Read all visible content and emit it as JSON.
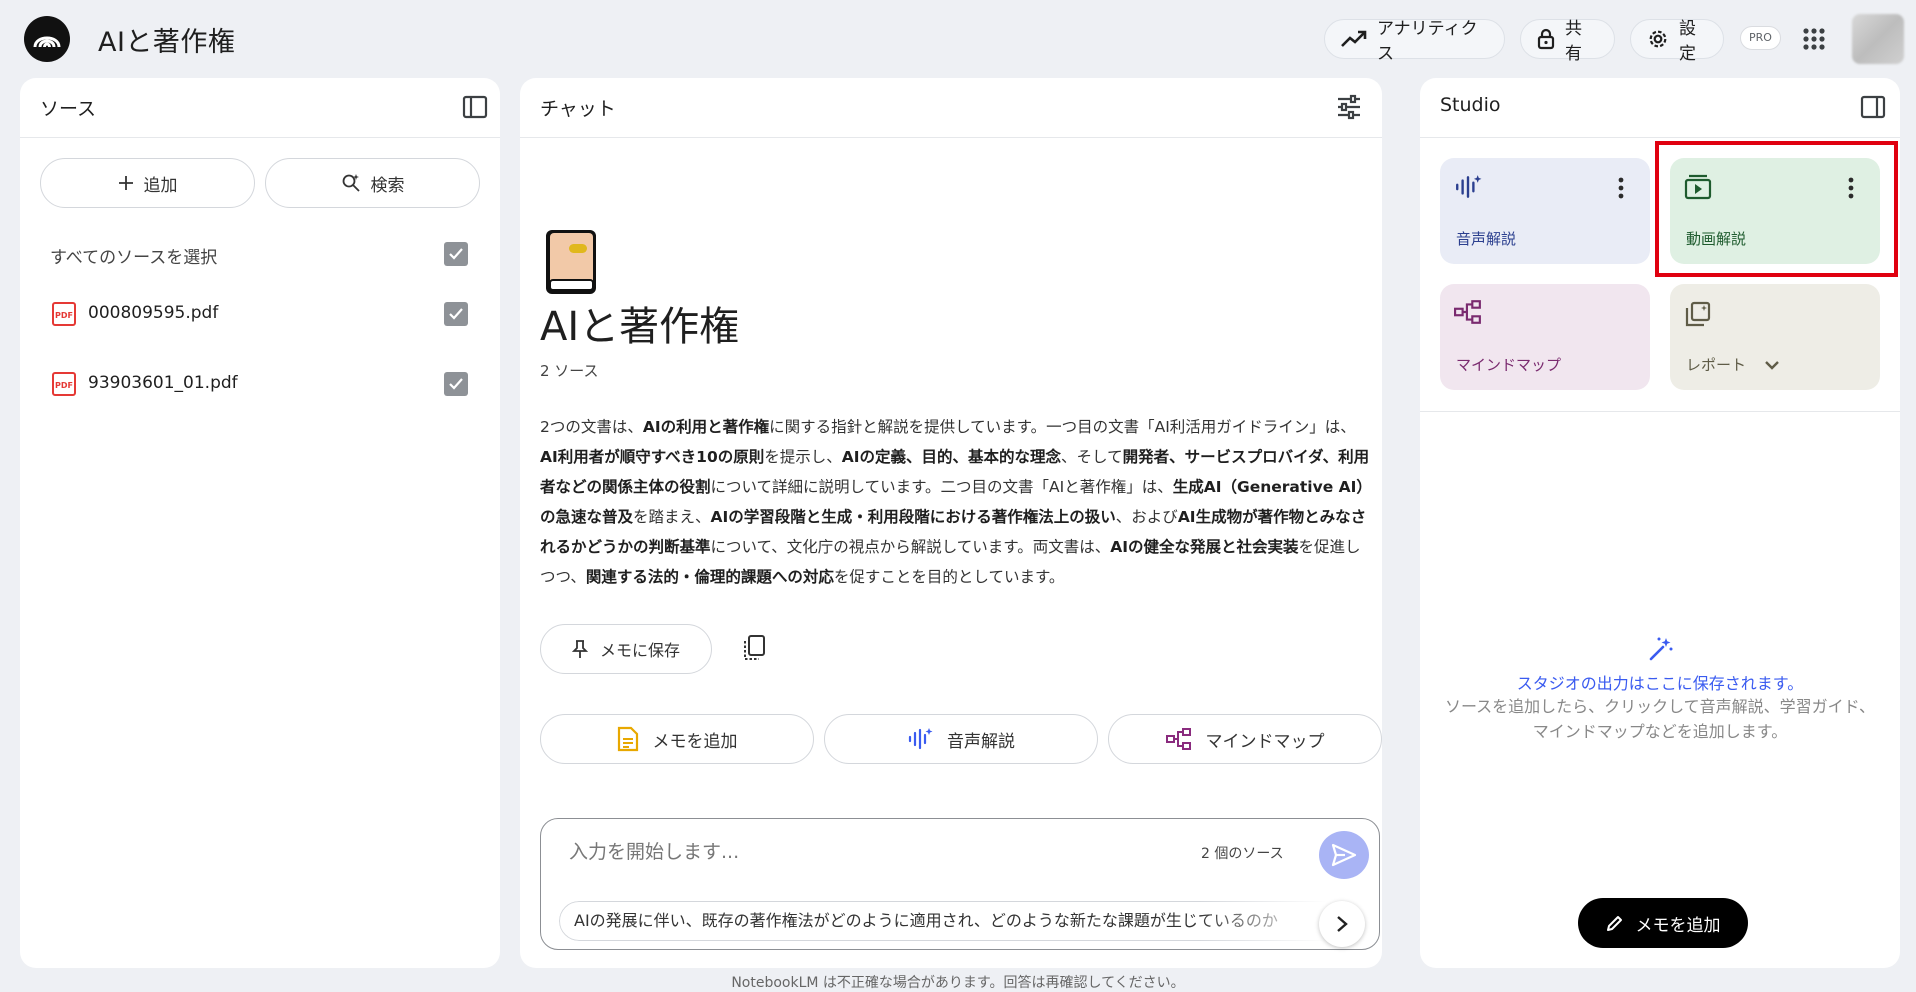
{
  "header": {
    "title": "AIと著作権",
    "analytics_label": "アナリティクス",
    "share_label": "共有",
    "settings_label": "設定",
    "pro_badge": "PRO"
  },
  "sources": {
    "title": "ソース",
    "add_label": "追加",
    "search_label": "検索",
    "select_all_label": "すべてのソースを選択",
    "items": [
      {
        "name": "000809595.pdf",
        "checked": true
      },
      {
        "name": "93903601_01.pdf",
        "checked": true
      }
    ]
  },
  "chat": {
    "title": "チャット",
    "notebook_title": "AIと著作権",
    "source_count": "2 ソース",
    "summary_segments": [
      {
        "t": "2つの文書は、",
        "b": false
      },
      {
        "t": "AIの利用と著作権",
        "b": true
      },
      {
        "t": "に関する指針と解説を提供しています。一つ目の文書「AI利活用ガイドライン」は、",
        "b": false
      },
      {
        "t": "AI利用者が順守すべき10の原則",
        "b": true
      },
      {
        "t": "を提示し、",
        "b": false
      },
      {
        "t": "AIの定義、目的、基本的な理念",
        "b": true
      },
      {
        "t": "、そして",
        "b": false
      },
      {
        "t": "開発者、サービスプロバイダ、利用者などの関係主体の役割",
        "b": true
      },
      {
        "t": "について詳細に説明しています。二つ目の文書「AIと著作権」は、",
        "b": false
      },
      {
        "t": "生成AI（Generative AI）の急速な普及",
        "b": true
      },
      {
        "t": "を踏まえ、",
        "b": false
      },
      {
        "t": "AIの学習段階と生成・利用段階における著作権法上の扱い",
        "b": true
      },
      {
        "t": "、および",
        "b": false
      },
      {
        "t": "AI生成物が著作物とみなされるかどうかの判断基準",
        "b": true
      },
      {
        "t": "について、文化庁の視点から解説しています。両文書は、",
        "b": false
      },
      {
        "t": "AIの健全な発展と社会実装",
        "b": true
      },
      {
        "t": "を促進しつつ、",
        "b": false
      },
      {
        "t": "関連する法的・倫理的課題への対応",
        "b": true
      },
      {
        "t": "を促すことを目的としています。",
        "b": false
      }
    ],
    "save_to_note_label": "メモに保存",
    "actions": {
      "add_note": "メモを追加",
      "audio_overview": "音声解説",
      "mind_map": "マインドマップ"
    },
    "input_placeholder": "入力を開始します...",
    "input_source_count": "2 個のソース",
    "suggestion": "AIの発展に伴い、既存の著作権法がどのように適用され、どのような新たな課題が生じているのか"
  },
  "studio": {
    "title": "Studio",
    "tiles": {
      "audio": {
        "label": "音声解説",
        "bg": "#e9ecf6",
        "color": "#2b3f8f"
      },
      "video": {
        "label": "動画解説",
        "bg": "#dff0e3",
        "color": "#1e5b2e"
      },
      "mindmap": {
        "label": "マインドマップ",
        "bg": "#f1e6ef",
        "color": "#7a2a6f"
      },
      "report": {
        "label": "レポート",
        "bg": "#eeede6",
        "color": "#5f5c47"
      }
    },
    "empty_title": "スタジオの出力はここに保存されます。",
    "empty_desc": "ソースを追加したら、クリックして音声解説、学習ガイド、マインドマップなどを追加します。",
    "add_note_label": "メモを追加"
  },
  "footer": {
    "disclaimer": "NotebookLM は不正確な場合があります。回答は再確認してください。"
  },
  "colors": {
    "accent": "#3a5bf0",
    "highlight": "#e0000f",
    "send_button": "#a9b4f5"
  }
}
